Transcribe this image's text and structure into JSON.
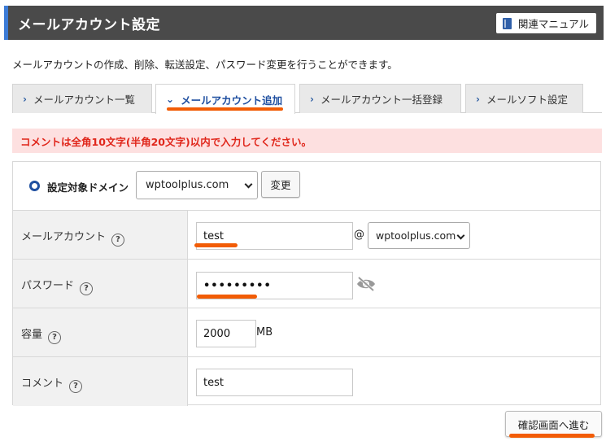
{
  "header": {
    "title": "メールアカウント設定",
    "manual_label": "関連マニュアル"
  },
  "description": "メールアカウントの作成、削除、転送設定、パスワード変更を行うことができます。",
  "tabs": [
    {
      "label": "メールアカウント一覧",
      "active": false
    },
    {
      "label": "メールアカウント追加",
      "active": true
    },
    {
      "label": "メールアカウント一括登録",
      "active": false
    },
    {
      "label": "メールソフト設定",
      "active": false
    }
  ],
  "error_message": "コメントは全角10文字(半角20文字)以内で入力してください。",
  "domain_selector": {
    "label": "設定対象ドメイン",
    "selected": "wptoolplus.com",
    "change_label": "変更"
  },
  "form": {
    "account": {
      "label": "メールアカウント",
      "value": "test",
      "at": "@",
      "domain": "wptoolplus.com"
    },
    "password": {
      "label": "パスワード",
      "value": "•••••••••"
    },
    "capacity": {
      "label": "容量",
      "value": "2000",
      "unit": "MB"
    },
    "comment": {
      "label": "コメント",
      "value": "test"
    },
    "help_glyph": "?"
  },
  "confirm_label": "確認画面へ進む",
  "colors": {
    "accent": "#f25c05",
    "header_bg": "#4a4a4a",
    "link_blue": "#1f4fa0",
    "error": "#e0261b"
  }
}
